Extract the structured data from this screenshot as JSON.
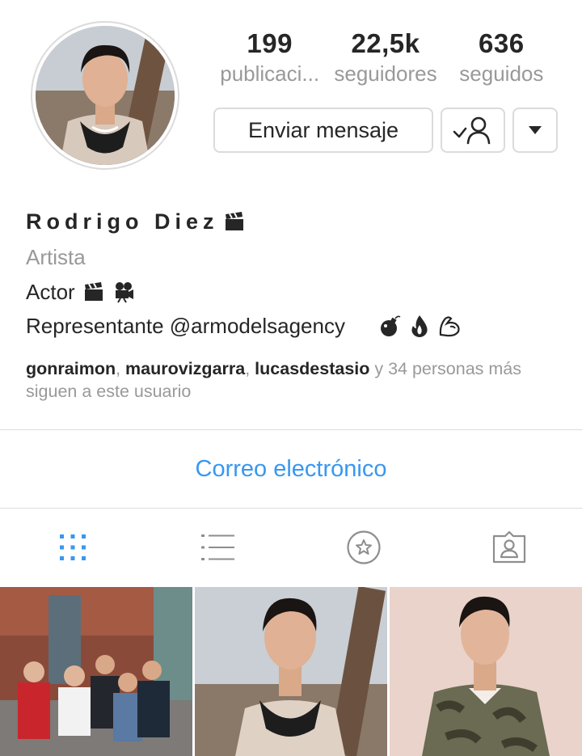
{
  "profile": {
    "name": "Rodrigo Diez",
    "category": "Artista",
    "bio_line1": "Actor",
    "bio_line2": "Representante @armodelsagency",
    "avatar_icon": "profile-photo"
  },
  "stats": {
    "posts_count": "199",
    "posts_label": "publicaci...",
    "followers_count": "22,5k",
    "followers_label": "seguidores",
    "following_count": "636",
    "following_label": "seguidos"
  },
  "actions": {
    "message_label": "Enviar mensaje",
    "following_icon": "following-check-person-icon",
    "more_icon": "caret-down-icon"
  },
  "followed_by": {
    "users": [
      "gonraimon",
      "maurovizgarra",
      "lucasdestasio"
    ],
    "suffix": " y 34 personas más siguen a este usuario"
  },
  "email_link": "Correo electrónico",
  "tabs": [
    {
      "name": "grid",
      "icon": "grid-icon",
      "active": true
    },
    {
      "name": "list",
      "icon": "list-icon",
      "active": false
    },
    {
      "name": "saved",
      "icon": "star-circle-icon",
      "active": false
    },
    {
      "name": "tagged",
      "icon": "tagged-person-icon",
      "active": false
    }
  ],
  "colors": {
    "accent": "#3897f0",
    "muted": "#999999",
    "border": "#dbdbdb",
    "text": "#262626"
  },
  "posts": [
    {
      "description": "group-photo"
    },
    {
      "description": "bandana-portrait"
    },
    {
      "description": "camo-jacket-portrait"
    }
  ]
}
